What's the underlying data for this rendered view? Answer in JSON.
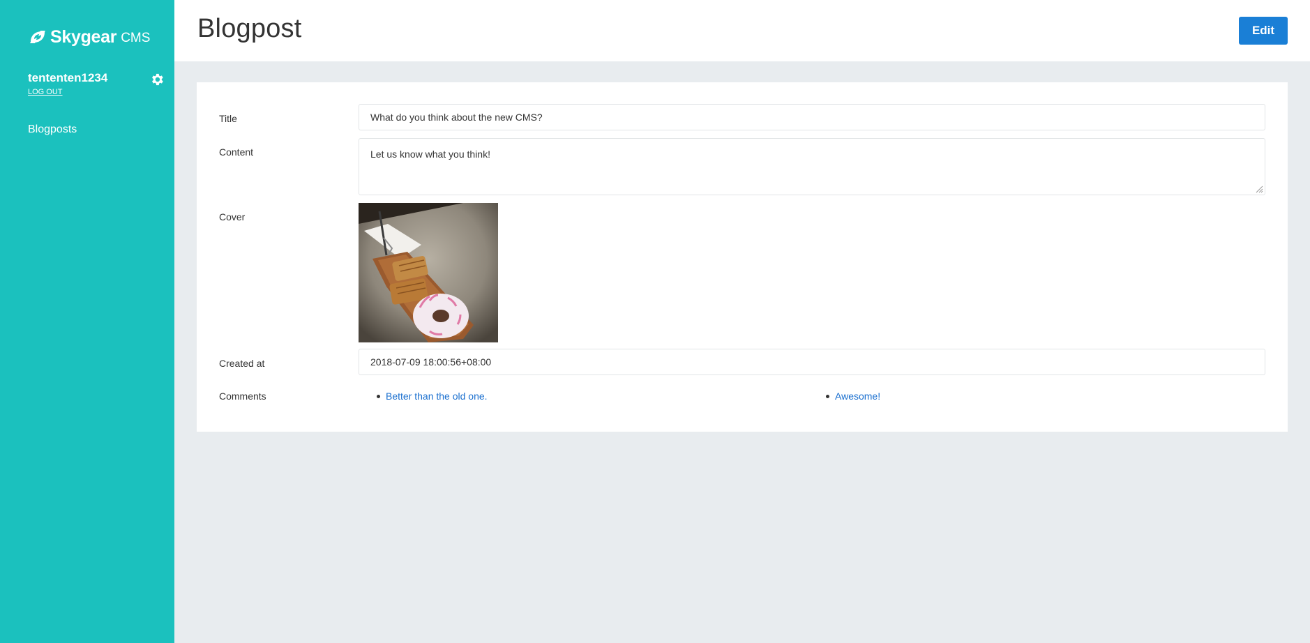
{
  "app": {
    "brand_name": "Skygear",
    "brand_suffix": "CMS"
  },
  "user": {
    "username": "tententen1234",
    "logout_label": "LOG OUT"
  },
  "sidebar": {
    "items": [
      {
        "label": "Blogposts"
      }
    ]
  },
  "header": {
    "title": "Blogpost",
    "edit_label": "Edit"
  },
  "record": {
    "fields": {
      "title": {
        "label": "Title",
        "value": "What do you think about the new CMS?"
      },
      "content": {
        "label": "Content",
        "value": "Let us know what you think!"
      },
      "cover": {
        "label": "Cover"
      },
      "created_at": {
        "label": "Created at",
        "value": "2018-07-09 18:00:56+08:00"
      },
      "comments": {
        "label": "Comments",
        "items": [
          "Better than the old one.",
          "Awesome!"
        ]
      }
    }
  },
  "colors": {
    "sidebar_bg": "#1bc1be",
    "primary_button": "#1a7fd6",
    "link": "#1a6fcf",
    "page_bg": "#e8ecef"
  },
  "icons": {
    "logo": "skygear-logo-icon",
    "settings": "gear-icon"
  }
}
